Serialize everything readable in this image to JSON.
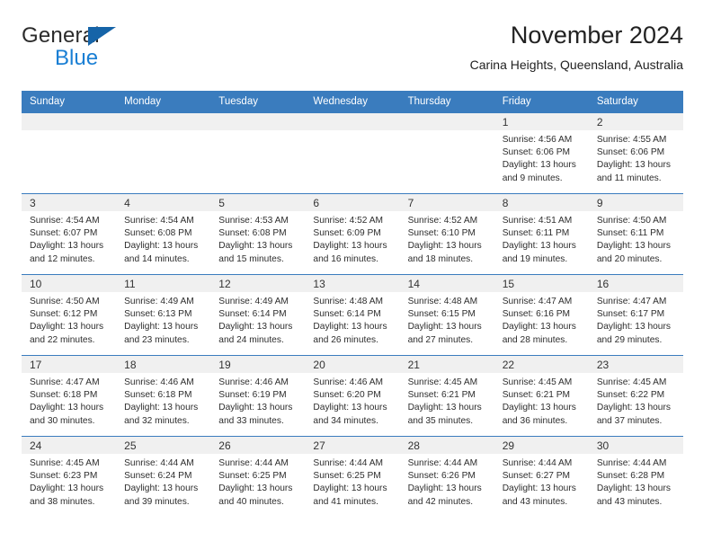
{
  "brand": {
    "name_part1": "General",
    "name_part2": "Blue",
    "accent_color": "#1a7fd4",
    "triangle_color": "#1664a8"
  },
  "header": {
    "title": "November 2024",
    "subtitle": "Carina Heights, Queensland, Australia"
  },
  "calendar": {
    "header_bg": "#3a7cbe",
    "daynum_bg": "#f0f0f0",
    "weekday_labels": [
      "Sunday",
      "Monday",
      "Tuesday",
      "Wednesday",
      "Thursday",
      "Friday",
      "Saturday"
    ],
    "weeks": [
      [
        {
          "day": "",
          "lines": []
        },
        {
          "day": "",
          "lines": []
        },
        {
          "day": "",
          "lines": []
        },
        {
          "day": "",
          "lines": []
        },
        {
          "day": "",
          "lines": []
        },
        {
          "day": "1",
          "lines": [
            "Sunrise: 4:56 AM",
            "Sunset: 6:06 PM",
            "Daylight: 13 hours",
            "and 9 minutes."
          ]
        },
        {
          "day": "2",
          "lines": [
            "Sunrise: 4:55 AM",
            "Sunset: 6:06 PM",
            "Daylight: 13 hours",
            "and 11 minutes."
          ]
        }
      ],
      [
        {
          "day": "3",
          "lines": [
            "Sunrise: 4:54 AM",
            "Sunset: 6:07 PM",
            "Daylight: 13 hours",
            "and 12 minutes."
          ]
        },
        {
          "day": "4",
          "lines": [
            "Sunrise: 4:54 AM",
            "Sunset: 6:08 PM",
            "Daylight: 13 hours",
            "and 14 minutes."
          ]
        },
        {
          "day": "5",
          "lines": [
            "Sunrise: 4:53 AM",
            "Sunset: 6:08 PM",
            "Daylight: 13 hours",
            "and 15 minutes."
          ]
        },
        {
          "day": "6",
          "lines": [
            "Sunrise: 4:52 AM",
            "Sunset: 6:09 PM",
            "Daylight: 13 hours",
            "and 16 minutes."
          ]
        },
        {
          "day": "7",
          "lines": [
            "Sunrise: 4:52 AM",
            "Sunset: 6:10 PM",
            "Daylight: 13 hours",
            "and 18 minutes."
          ]
        },
        {
          "day": "8",
          "lines": [
            "Sunrise: 4:51 AM",
            "Sunset: 6:11 PM",
            "Daylight: 13 hours",
            "and 19 minutes."
          ]
        },
        {
          "day": "9",
          "lines": [
            "Sunrise: 4:50 AM",
            "Sunset: 6:11 PM",
            "Daylight: 13 hours",
            "and 20 minutes."
          ]
        }
      ],
      [
        {
          "day": "10",
          "lines": [
            "Sunrise: 4:50 AM",
            "Sunset: 6:12 PM",
            "Daylight: 13 hours",
            "and 22 minutes."
          ]
        },
        {
          "day": "11",
          "lines": [
            "Sunrise: 4:49 AM",
            "Sunset: 6:13 PM",
            "Daylight: 13 hours",
            "and 23 minutes."
          ]
        },
        {
          "day": "12",
          "lines": [
            "Sunrise: 4:49 AM",
            "Sunset: 6:14 PM",
            "Daylight: 13 hours",
            "and 24 minutes."
          ]
        },
        {
          "day": "13",
          "lines": [
            "Sunrise: 4:48 AM",
            "Sunset: 6:14 PM",
            "Daylight: 13 hours",
            "and 26 minutes."
          ]
        },
        {
          "day": "14",
          "lines": [
            "Sunrise: 4:48 AM",
            "Sunset: 6:15 PM",
            "Daylight: 13 hours",
            "and 27 minutes."
          ]
        },
        {
          "day": "15",
          "lines": [
            "Sunrise: 4:47 AM",
            "Sunset: 6:16 PM",
            "Daylight: 13 hours",
            "and 28 minutes."
          ]
        },
        {
          "day": "16",
          "lines": [
            "Sunrise: 4:47 AM",
            "Sunset: 6:17 PM",
            "Daylight: 13 hours",
            "and 29 minutes."
          ]
        }
      ],
      [
        {
          "day": "17",
          "lines": [
            "Sunrise: 4:47 AM",
            "Sunset: 6:18 PM",
            "Daylight: 13 hours",
            "and 30 minutes."
          ]
        },
        {
          "day": "18",
          "lines": [
            "Sunrise: 4:46 AM",
            "Sunset: 6:18 PM",
            "Daylight: 13 hours",
            "and 32 minutes."
          ]
        },
        {
          "day": "19",
          "lines": [
            "Sunrise: 4:46 AM",
            "Sunset: 6:19 PM",
            "Daylight: 13 hours",
            "and 33 minutes."
          ]
        },
        {
          "day": "20",
          "lines": [
            "Sunrise: 4:46 AM",
            "Sunset: 6:20 PM",
            "Daylight: 13 hours",
            "and 34 minutes."
          ]
        },
        {
          "day": "21",
          "lines": [
            "Sunrise: 4:45 AM",
            "Sunset: 6:21 PM",
            "Daylight: 13 hours",
            "and 35 minutes."
          ]
        },
        {
          "day": "22",
          "lines": [
            "Sunrise: 4:45 AM",
            "Sunset: 6:21 PM",
            "Daylight: 13 hours",
            "and 36 minutes."
          ]
        },
        {
          "day": "23",
          "lines": [
            "Sunrise: 4:45 AM",
            "Sunset: 6:22 PM",
            "Daylight: 13 hours",
            "and 37 minutes."
          ]
        }
      ],
      [
        {
          "day": "24",
          "lines": [
            "Sunrise: 4:45 AM",
            "Sunset: 6:23 PM",
            "Daylight: 13 hours",
            "and 38 minutes."
          ]
        },
        {
          "day": "25",
          "lines": [
            "Sunrise: 4:44 AM",
            "Sunset: 6:24 PM",
            "Daylight: 13 hours",
            "and 39 minutes."
          ]
        },
        {
          "day": "26",
          "lines": [
            "Sunrise: 4:44 AM",
            "Sunset: 6:25 PM",
            "Daylight: 13 hours",
            "and 40 minutes."
          ]
        },
        {
          "day": "27",
          "lines": [
            "Sunrise: 4:44 AM",
            "Sunset: 6:25 PM",
            "Daylight: 13 hours",
            "and 41 minutes."
          ]
        },
        {
          "day": "28",
          "lines": [
            "Sunrise: 4:44 AM",
            "Sunset: 6:26 PM",
            "Daylight: 13 hours",
            "and 42 minutes."
          ]
        },
        {
          "day": "29",
          "lines": [
            "Sunrise: 4:44 AM",
            "Sunset: 6:27 PM",
            "Daylight: 13 hours",
            "and 43 minutes."
          ]
        },
        {
          "day": "30",
          "lines": [
            "Sunrise: 4:44 AM",
            "Sunset: 6:28 PM",
            "Daylight: 13 hours",
            "and 43 minutes."
          ]
        }
      ]
    ]
  }
}
